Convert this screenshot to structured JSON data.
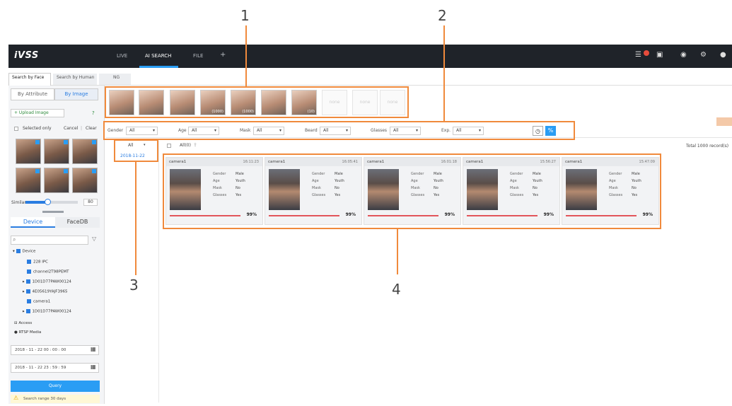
{
  "app": {
    "logo": "iVSS"
  },
  "nav": {
    "items": [
      "LIVE",
      "AI SEARCH",
      "FILE",
      "+"
    ],
    "active": "AI SEARCH"
  },
  "subtabs": [
    "Search by Face",
    "Search by Human",
    "NG"
  ],
  "left": {
    "by_attribute": "By Attribute",
    "by_image": "By Image",
    "upload": "+ Upload Image",
    "help": "?",
    "selected_only": "Selected only",
    "cancel": "Cancel",
    "clear": "Clear",
    "similar_label": "Similar",
    "similar_value": "80",
    "device_tab": "Device",
    "facedb_tab": "FaceDB",
    "tree": [
      "Device",
      "228 IPC",
      "channel2T98PEMT",
      "1D01D77PAW00124",
      "4E05619YAJF3965",
      "camera1",
      "1D01D77PAW00124",
      "Access",
      "RTSP Media"
    ],
    "start_time": "2018 - 11 - 22  00 : 00 : 00",
    "end_time": "2018 - 11 - 22  23 : 59 : 59",
    "query": "Query",
    "warning": "Search range 30 days"
  },
  "strip": {
    "counts": [
      "(1000)",
      "(1000)",
      "(10)"
    ],
    "placeholder": "none"
  },
  "filters": [
    {
      "label": "Gender",
      "value": "All"
    },
    {
      "label": "Age",
      "value": "All"
    },
    {
      "label": "Mask",
      "value": "All"
    },
    {
      "label": "Beard",
      "value": "All"
    },
    {
      "label": "Glasses",
      "value": "All"
    },
    {
      "label": "Exp.",
      "value": "All"
    }
  ],
  "dates": {
    "all": "All",
    "date": "2018-11-22"
  },
  "results": {
    "all_label": "All(0)",
    "total": "Total 1000 record(s)"
  },
  "cards": [
    {
      "camera": "camera1",
      "time": "16:11:23",
      "Gender": "Male",
      "Age": "Youth",
      "Mask": "No",
      "Glasses": "Yes",
      "score": "99%"
    },
    {
      "camera": "camera1",
      "time": "16:05:41",
      "Gender": "Male",
      "Age": "Youth",
      "Mask": "No",
      "Glasses": "Yes",
      "score": "99%"
    },
    {
      "camera": "camera1",
      "time": "16:01:18",
      "Gender": "Male",
      "Age": "Youth",
      "Mask": "No",
      "Glasses": "Yes",
      "score": "99%"
    },
    {
      "camera": "camera1",
      "time": "15:56:27",
      "Gender": "Male",
      "Age": "Youth",
      "Mask": "No",
      "Glasses": "Yes",
      "score": "99%"
    },
    {
      "camera": "camera1",
      "time": "15:47:09",
      "Gender": "Male",
      "Age": "Youth",
      "Mask": "No",
      "Glasses": "Yes",
      "score": "99%"
    }
  ],
  "callouts": [
    "1",
    "2",
    "3",
    "4"
  ]
}
